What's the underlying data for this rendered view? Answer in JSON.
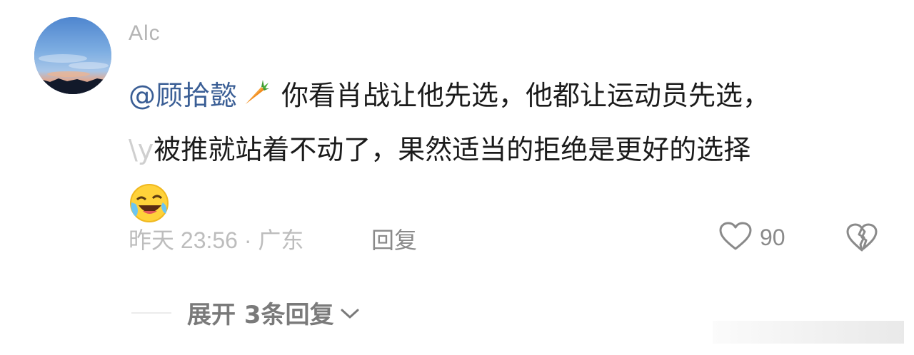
{
  "comment": {
    "username": "Alc",
    "mention": "@顾拾懿",
    "line1": "你看肖战让他先选，他都让运动员先选，",
    "line2_prefix": "\\y",
    "line2": "被推就站着不动了，果然适当的拒绝是更好的选择",
    "carrot_icon": "carrot-icon",
    "emoji_icon": "laughing-crying-emoji"
  },
  "meta": {
    "time_location": "昨天 23:56 · 广东",
    "reply_label": "回复",
    "like_count": "90"
  },
  "replies": {
    "expand_label": "展开 3条回复"
  }
}
